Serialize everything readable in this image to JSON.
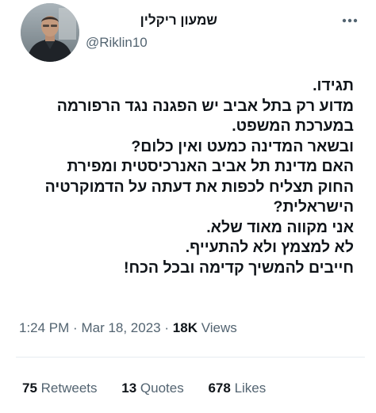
{
  "author": {
    "display_name": "שמעון ריקלין",
    "handle": "@Riklin10",
    "avatar_icon": "profile-photo"
  },
  "more_icon": "more-horizontal-icon",
  "tweet": {
    "lines": [
      "תגידו.",
      "מדוע רק בתל אביב יש הפגנה נגד הרפורמה",
      "במערכת המשפט.",
      "ובשאר המדינה כמעט ואין כלום?",
      "האם מדינת תל אביב האנרכיסטית ומפירת",
      "החוק תצליח לכפות את דעתה על הדמוקרטיה",
      "הישראלית?",
      "אני מקווה מאוד שלא.",
      "לא למצמץ ולא להתעייף.",
      "חייבים להמשיך קדימה ובכל הכח!"
    ]
  },
  "meta": {
    "time": "1:24 PM",
    "separator": "·",
    "date": "Mar 18, 2023",
    "views_count": "18K",
    "views_label": "Views"
  },
  "stats": {
    "retweets_count": "75",
    "retweets_label": "Retweets",
    "quotes_count": "13",
    "quotes_label": "Quotes",
    "likes_count": "678",
    "likes_label": "Likes"
  },
  "colors": {
    "text_primary": "#0f1419",
    "text_secondary": "#536471",
    "divider": "#e6ecf0"
  }
}
